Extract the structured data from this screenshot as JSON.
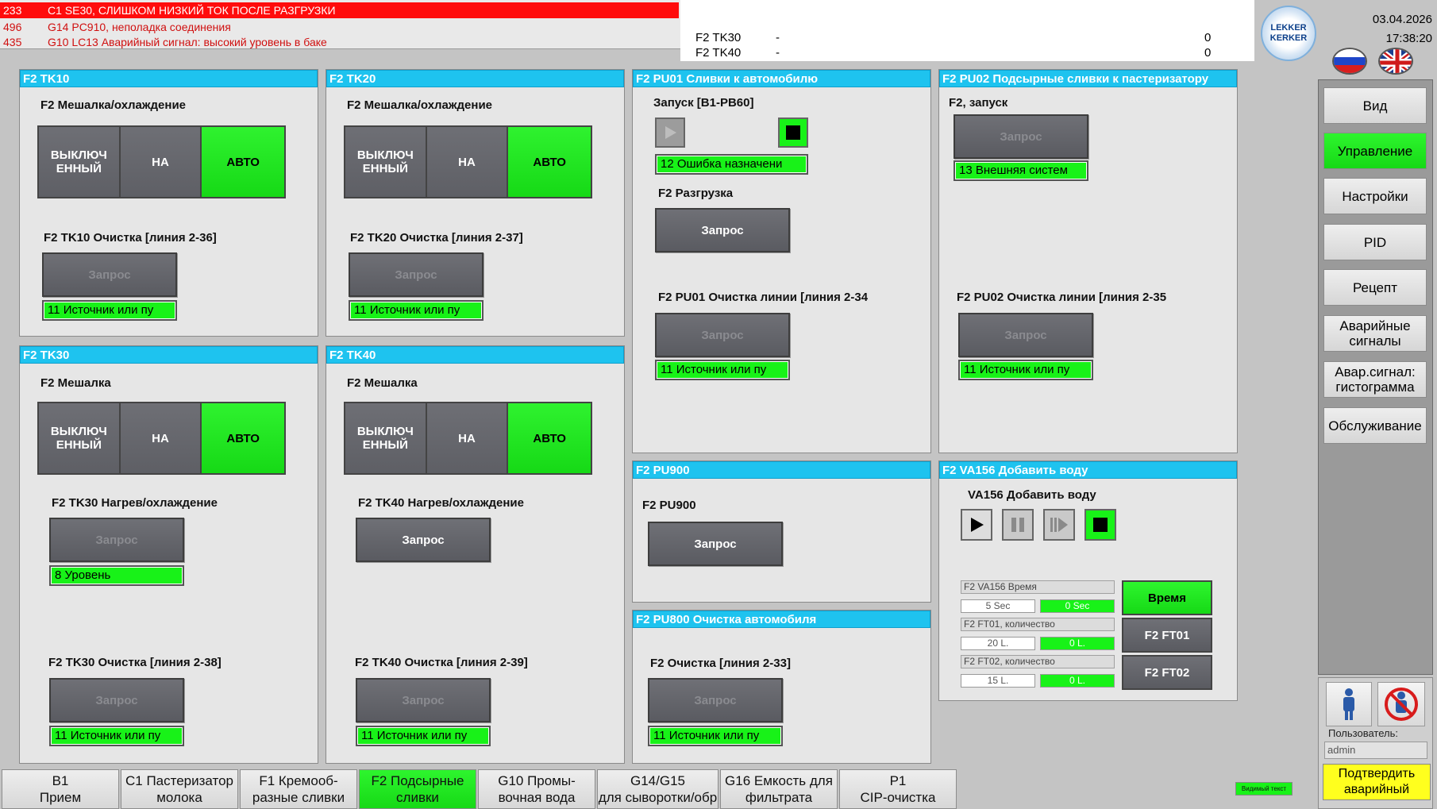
{
  "alarms": [
    {
      "num": "233",
      "text": "C1 SE30, СЛИШКОМ НИЗКИЙ ТОК ПОСЛЕ РАЗГРУЗКИ"
    },
    {
      "num": "496",
      "text": "G14 PC910, неполадка соединения"
    },
    {
      "num": "435",
      "text": "G10 LC13 Аварийный сигнал: высокий уровень в баке"
    }
  ],
  "info": {
    "rows": [
      {
        "name": "F2 TK30",
        "dash": "-",
        "value": "0"
      },
      {
        "name": "F2 TK40",
        "dash": "-",
        "value": "0"
      }
    ]
  },
  "header": {
    "logo": "LEKKER KERKER",
    "date": "03.04.2026",
    "time": "17:38:20"
  },
  "seg_labels": {
    "off": "ВЫКЛЮЧ ЕННЫЙ",
    "on": "НА",
    "auto": "АВТО"
  },
  "request": "Запрос",
  "tk10": {
    "title": "F2 TK10",
    "mixer": "F2 Мешалка/охлаждение",
    "clean": "F2 TK10 Очистка [линия 2-36]",
    "status": "11 Источник или пу"
  },
  "tk20": {
    "title": "F2 TK20",
    "mixer": "F2 Мешалка/охлаждение",
    "clean": "F2 TK20 Очистка [линия 2-37]",
    "status": "11 Источник или пу"
  },
  "tk30": {
    "title": "F2 TK30",
    "mixer": "F2 Мешалка",
    "heat": "F2 TK30 Нагрев/охлаждение",
    "heat_status": "8 Уровень",
    "clean": "F2 TK30 Очистка [линия 2-38]",
    "status": "11 Источник или пу"
  },
  "tk40": {
    "title": "F2 TK40",
    "mixer": "F2 Мешалка",
    "heat": "F2 TK40 Нагрев/охлаждение",
    "clean": "F2 TK40 Очистка [линия 2-39]",
    "status": "11 Источник или пу"
  },
  "pu01": {
    "title": "F2 PU01 Сливки к автомобилю",
    "start": "Запуск [B1-PB60]",
    "start_status": "12 Ошибка назначени",
    "unload": "F2 Разгрузка",
    "clean": "F2 PU01 Очистка линии [линия 2-34",
    "status": "11 Источник или пу"
  },
  "pu02": {
    "title": "F2 PU02 Подсырные сливки к пастеризатору",
    "start": "F2, запуск",
    "start_status": "13 Внешняя систем",
    "clean": "F2 PU02 Очистка линии [линия 2-35",
    "status": "11 Источник или пу"
  },
  "pu900": {
    "title": "F2 PU900",
    "label": "F2 PU900"
  },
  "pu800": {
    "title": "F2 PU800 Очистка автомобиля",
    "clean": "F2 Очистка [линия 2-33]",
    "status": "11 Источник или пу"
  },
  "va156": {
    "title": "F2 VA156 Добавить воду",
    "label": "VA156 Добавить воду",
    "fields": [
      {
        "label": "F2 VA156 Время",
        "set": "5 Sec",
        "act": "0 Sec",
        "button": "Время"
      },
      {
        "label": "F2 FT01, количество",
        "set": "20 L.",
        "act": "0 L.",
        "button": "F2 FT01"
      },
      {
        "label": "F2 FT02, количество",
        "set": "15 L.",
        "act": "0 L.",
        "button": "F2 FT02"
      }
    ]
  },
  "nav": [
    {
      "label": "Вид"
    },
    {
      "label": "Управление"
    },
    {
      "label": "Настройки"
    },
    {
      "label": "PID"
    },
    {
      "label": "Рецепт"
    },
    {
      "label": "Аварийные сигналы"
    },
    {
      "label": "Авар.сигнал: гистограмма"
    },
    {
      "label": "Обслуживание"
    }
  ],
  "user": {
    "label": "Пользователь:",
    "name": "admin",
    "confirm": "Подтвердить аварийный сигнал"
  },
  "tabs": [
    {
      "l1": "B1",
      "l2": "Прием"
    },
    {
      "l1": "C1 Пастеризатор",
      "l2": "молока"
    },
    {
      "l1": "F1 Кремооб-",
      "l2": "разные сливки"
    },
    {
      "l1": "F2 Подсырные",
      "l2": "сливки"
    },
    {
      "l1": "G10 Промы-",
      "l2": "вочная вода"
    },
    {
      "l1": "G14/G15",
      "l2": "для сыворотки/обр"
    },
    {
      "l1": "G16 Емкость для",
      "l2": "фильтрата"
    },
    {
      "l1": "P1",
      "l2": "CIP-очистка"
    }
  ],
  "visible_text": "Видимый текст",
  "colors": {
    "header": "#1ec3ef",
    "active": "#18f218",
    "alarm": "#ff0c0c"
  }
}
